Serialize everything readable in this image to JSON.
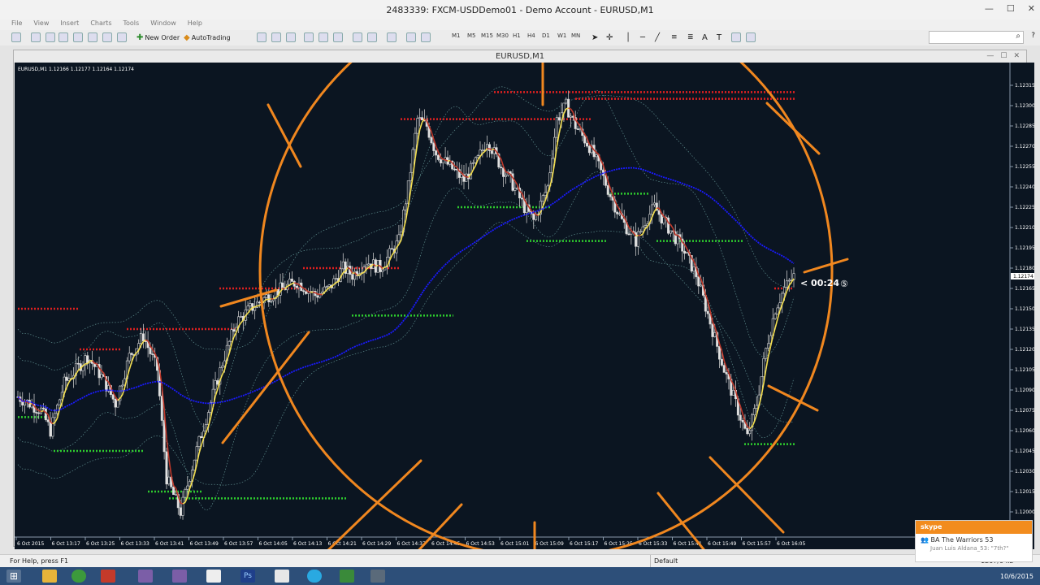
{
  "app": {
    "title": "2483339: FXCM-USDDemo01 - Demo Account - EURUSD,M1",
    "window_buttons": [
      "—",
      "☐",
      "✕"
    ]
  },
  "menu": [
    "File",
    "View",
    "Insert",
    "Charts",
    "Tools",
    "Window",
    "Help"
  ],
  "toolbar": {
    "new_order": "New Order",
    "autotrading": "AutoTrading",
    "timeframes": [
      "M1",
      "M5",
      "M15",
      "M30",
      "H1",
      "H4",
      "D1",
      "W1",
      "MN"
    ]
  },
  "chart_window": {
    "title": "EURUSD,M1",
    "info": "EURUSD,M1  1.12166 1.12177 1.12164 1.12174",
    "price_axis": [
      "1.12315",
      "1.12300",
      "1.12285",
      "1.12270",
      "1.12255",
      "1.12240",
      "1.12225",
      "1.12210",
      "1.12195",
      "1.12180",
      "1.12165",
      "1.12150",
      "1.12135",
      "1.12120",
      "1.12105",
      "1.12090",
      "1.12075",
      "1.12060",
      "1.12045",
      "1.12030",
      "1.12015",
      "1.12000"
    ],
    "current_price": "1.12174",
    "time_axis": [
      "6 Oct 2015",
      "6 Oct 13:17",
      "6 Oct 13:25",
      "6 Oct 13:33",
      "6 Oct 13:41",
      "6 Oct 13:49",
      "6 Oct 13:57",
      "6 Oct 14:05",
      "6 Oct 14:13",
      "6 Oct 14:21",
      "6 Oct 14:29",
      "6 Oct 14:37",
      "6 Oct 14:45",
      "6 Oct 14:53",
      "6 Oct 15:01",
      "6 Oct 15:09",
      "6 Oct 15:17",
      "6 Oct 15:25",
      "6 Oct 15:33",
      "6 Oct 15:41",
      "6 Oct 15:49",
      "6 Oct 15:57",
      "6 Oct 16:05"
    ],
    "countdown": "< 00:24"
  },
  "status": {
    "help": "For Help, press F1",
    "profile": "Default",
    "traffic": "1267/0 kb"
  },
  "skype": {
    "brand": "skype",
    "group": "BA The Warriors 53",
    "message": "Juan Luis Aldana_53: \"7th?\""
  },
  "clock": {
    "date": "10/6/2015"
  },
  "colors": {
    "chart_bg": "#0b1521",
    "axis_bg": "#0b1521",
    "resistance": "#e02020",
    "support": "#2ecc2e",
    "fast_ma": "#f5e050",
    "slow_ma": "#1a1aff",
    "overlay": "#f0871f",
    "taskbar": "#2d4f79"
  }
}
